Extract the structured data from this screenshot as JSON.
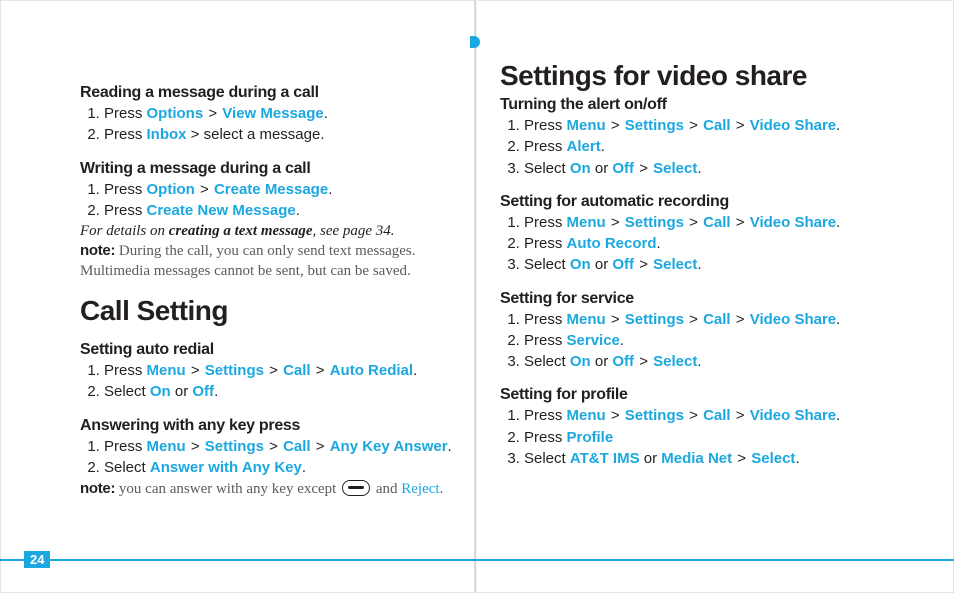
{
  "page_number": "24",
  "left": {
    "sec_reading": {
      "title": "Reading a message during a call",
      "steps": [
        {
          "pre": "Press ",
          "a": "Options",
          "gt": " > ",
          "b": "View Message",
          "post": "."
        },
        {
          "pre": "Press ",
          "a": "Inbox",
          "post": " > select a message."
        }
      ]
    },
    "sec_writing": {
      "title": "Writing a message during a call",
      "steps": [
        {
          "pre": "Press ",
          "a": "Option",
          "gt": " > ",
          "b": "Create Message",
          "post": "."
        },
        {
          "pre": "Press ",
          "a": "Create New Message",
          "post": "."
        }
      ],
      "italic_pre": "For details on ",
      "italic_strong": "creating a text message",
      "italic_post": ", see page 34.",
      "note_label": "note:",
      "note_body": " During the call, you can only send text messages. Multimedia messages cannot be sent, but can be saved."
    },
    "heading_call": "Call Setting",
    "sec_autoredial": {
      "title": "Setting auto redial",
      "step1": {
        "pre": "Press ",
        "a": "Menu",
        "b": "Settings",
        "c": "Call",
        "d": "Auto Redial",
        "post": "."
      },
      "step2": {
        "pre": "Select ",
        "a": "On",
        "mid": " or ",
        "b": "Off",
        "post": "."
      }
    },
    "sec_anykey": {
      "title": "Answering with any key press",
      "step1": {
        "pre": "Press ",
        "a": "Menu",
        "b": "Settings",
        "c": "Call",
        "d": "Any Key Answer",
        "post": "."
      },
      "step2": {
        "pre": "Select ",
        "a": "Answer with Any Key",
        "post": "."
      },
      "note_label": "note:",
      "note_body_pre": " you can answer with any key except ",
      "note_body_mid": " and ",
      "note_reject": "Reject",
      "note_body_post": "."
    }
  },
  "right": {
    "heading_video": "Settings for video share",
    "sec_alert": {
      "title": "Turning the alert on/off",
      "path": {
        "pre": "Press ",
        "a": "Menu",
        "b": "Settings",
        "c": "Call",
        "d": "Video Share",
        "post": "."
      },
      "step2": {
        "pre": "Press ",
        "a": "Alert",
        "post": "."
      },
      "step3": {
        "pre": "Select ",
        "a": "On",
        "mid": " or ",
        "b": "Off",
        "gt": " > ",
        "c": "Select",
        "post": "."
      }
    },
    "sec_rec": {
      "title": "Setting for automatic recording",
      "path": {
        "pre": "Press ",
        "a": "Menu",
        "b": "Settings",
        "c": "Call",
        "d": "Video Share",
        "post": "."
      },
      "step2": {
        "pre": "Press ",
        "a": "Auto Record",
        "post": "."
      },
      "step3": {
        "pre": "Select ",
        "a": "On",
        "mid": " or ",
        "b": "Off",
        "gt": " > ",
        "c": "Select",
        "post": "."
      }
    },
    "sec_service": {
      "title": "Setting for service",
      "path": {
        "pre": "Press ",
        "a": "Menu",
        "b": "Settings",
        "c": "Call",
        "d": "Video Share",
        "post": "."
      },
      "step2": {
        "pre": "Press ",
        "a": "Service",
        "post": "."
      },
      "step3": {
        "pre": "Select ",
        "a": "On",
        "mid": " or ",
        "b": "Off",
        "gt": " > ",
        "c": "Select",
        "post": "."
      }
    },
    "sec_profile": {
      "title": "Setting for profile",
      "path": {
        "pre": "Press ",
        "a": "Menu",
        "b": "Settings",
        "c": "Call",
        "d": "Video Share",
        "post": "."
      },
      "step2": {
        "pre": "Press ",
        "a": "Profile"
      },
      "step3": {
        "pre": "Select ",
        "a": "AT&T IMS",
        "mid": " or ",
        "b": "Media Net",
        "gt": " > ",
        "c": "Select",
        "post": "."
      }
    }
  }
}
